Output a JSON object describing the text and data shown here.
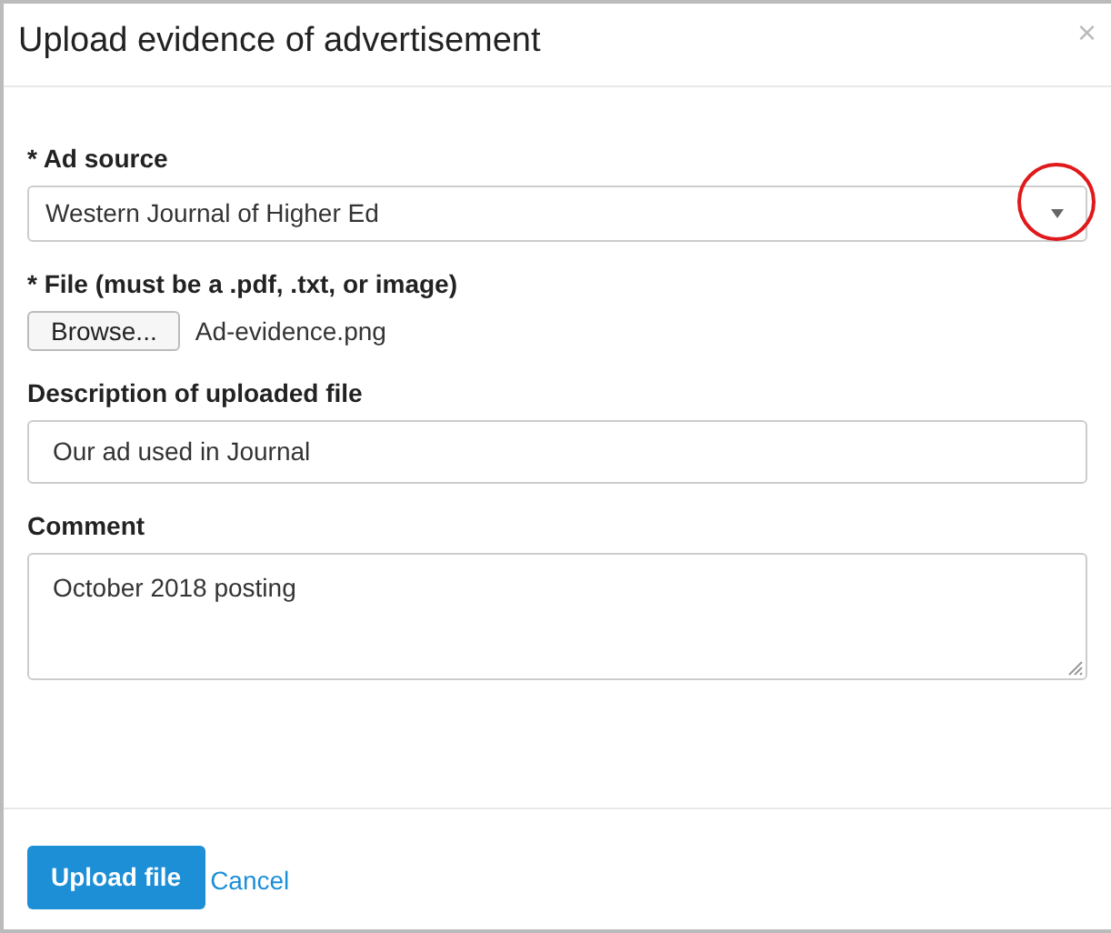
{
  "dialog": {
    "title": "Upload evidence of advertisement",
    "close": "×"
  },
  "fields": [
    {
      "kind": "select",
      "label": "* Ad source",
      "value": "Western Journal of Higher Ed",
      "highlighted": true
    },
    {
      "kind": "file",
      "label": "* File (must be a .pdf, .txt, or image)",
      "button": "Browse...",
      "value": "Ad-evidence.png"
    },
    {
      "kind": "input",
      "label": "Description of uploaded file",
      "value": "Our ad used in Journal"
    },
    {
      "kind": "textarea",
      "label": "Comment",
      "value": "October 2018 posting"
    }
  ],
  "buttons": {
    "primary": "Upload file",
    "link": "Cancel"
  }
}
